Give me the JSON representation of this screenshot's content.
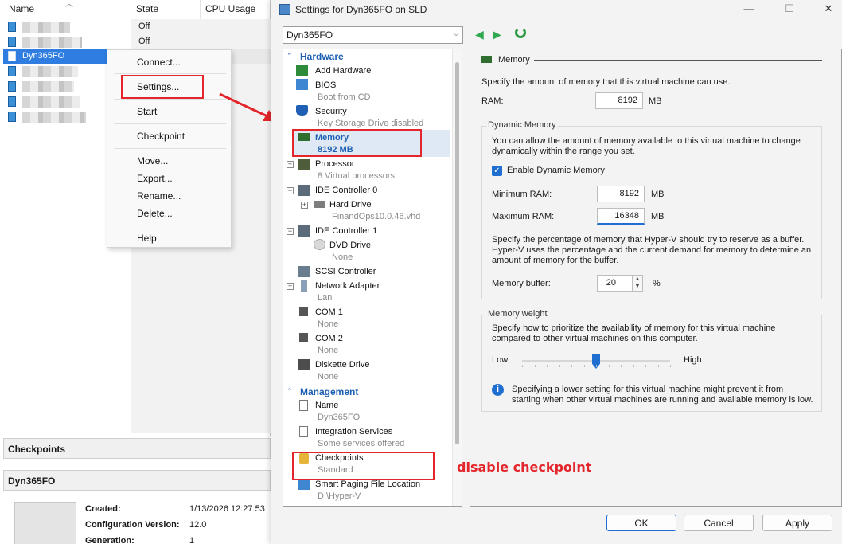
{
  "manager": {
    "columns": {
      "name": "Name",
      "state": "State",
      "cpu": "CPU Usage"
    },
    "vms": [
      {
        "name": "",
        "state": "Off"
      },
      {
        "name": "",
        "state": "Off"
      },
      {
        "name": "Dyn365FO",
        "state": ""
      },
      {
        "name": "",
        "state": ""
      },
      {
        "name": "",
        "state": ""
      },
      {
        "name": "",
        "state": ""
      },
      {
        "name": "",
        "state": ""
      }
    ],
    "checkpoints_header": "Checkpoints",
    "details_header": "Dyn365FO",
    "details": [
      {
        "label": "Created:",
        "value": "1/13/2026 12:27:53"
      },
      {
        "label": "Configuration Version:",
        "value": "12.0"
      },
      {
        "label": "Generation:",
        "value": "1"
      }
    ]
  },
  "context_menu": {
    "items": [
      "Connect...",
      "Settings...",
      "Start",
      "Checkpoint",
      "Move...",
      "Export...",
      "Rename...",
      "Delete...",
      "Help"
    ]
  },
  "dialog": {
    "title": "Settings for Dyn365FO on SLD",
    "vm_select": "Dyn365FO",
    "tree": {
      "hardware_header": "Hardware",
      "management_header": "Management",
      "add_hardware": "Add Hardware",
      "bios": {
        "label": "BIOS",
        "sub": "Boot from CD"
      },
      "security": {
        "label": "Security",
        "sub": "Key Storage Drive disabled"
      },
      "memory": {
        "label": "Memory",
        "sub": "8192 MB"
      },
      "processor": {
        "label": "Processor",
        "sub": "8 Virtual processors"
      },
      "ide0": {
        "label": "IDE Controller 0"
      },
      "hard_drive": {
        "label": "Hard Drive",
        "sub": "FinandOps10.0.46.vhd"
      },
      "ide1": {
        "label": "IDE Controller 1"
      },
      "dvd": {
        "label": "DVD Drive",
        "sub": "None"
      },
      "scsi": {
        "label": "SCSI Controller"
      },
      "network": {
        "label": "Network Adapter",
        "sub": "Lan"
      },
      "com1": {
        "label": "COM 1",
        "sub": "None"
      },
      "com2": {
        "label": "COM 2",
        "sub": "None"
      },
      "diskette": {
        "label": "Diskette Drive",
        "sub": "None"
      },
      "name": {
        "label": "Name",
        "sub": "Dyn365FO"
      },
      "integration": {
        "label": "Integration Services",
        "sub": "Some services offered"
      },
      "checkpoints": {
        "label": "Checkpoints",
        "sub": "Standard"
      },
      "smart_paging": {
        "label": "Smart Paging File Location",
        "sub": "D:\\Hyper-V"
      }
    },
    "panel": {
      "heading": "Memory",
      "intro": "Specify the amount of memory that this virtual machine can use.",
      "ram_label": "RAM:",
      "ram_value": "8192",
      "unit_mb": "MB",
      "dynamic_title": "Dynamic Memory",
      "dynamic_desc_1": "You can allow the amount of memory available to this virtual machine to change",
      "dynamic_desc_2": "dynamically within the range you set.",
      "enable_dynamic": "Enable Dynamic Memory",
      "enable_dynamic_checked": true,
      "min_label": "Minimum RAM:",
      "min_value": "8192",
      "max_label": "Maximum RAM:",
      "max_value": "16348",
      "buffer_desc_1": "Specify the percentage of memory that Hyper-V should try to reserve as a buffer.",
      "buffer_desc_2": "Hyper-V uses the percentage and the current demand for memory to determine an",
      "buffer_desc_3": "amount of memory for the buffer.",
      "buffer_label": "Memory buffer:",
      "buffer_value": "20",
      "percent": "%",
      "weight_title": "Memory weight",
      "weight_desc_1": "Specify how to prioritize the availability of memory for this virtual machine",
      "weight_desc_2": "compared to other virtual machines on this computer.",
      "low": "Low",
      "high": "High",
      "weight_level": 0.5,
      "info_1": "Specifying a lower setting for this virtual machine might prevent it from",
      "info_2": "starting when other virtual machines are running and available memory is low."
    },
    "buttons": {
      "ok": "OK",
      "cancel": "Cancel",
      "apply": "Apply"
    }
  },
  "annotation": {
    "note": "disable checkpoint",
    "color": "#e3262b"
  }
}
